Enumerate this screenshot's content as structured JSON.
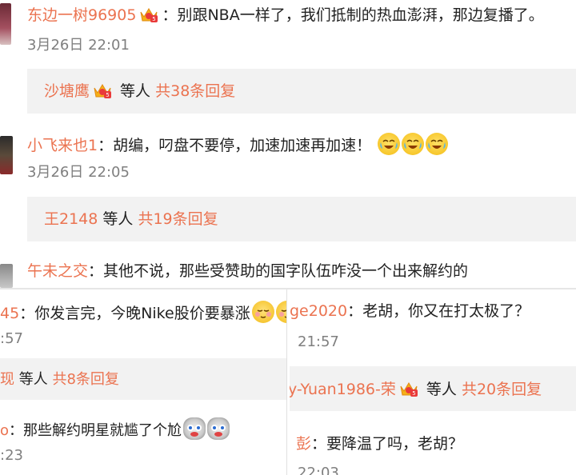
{
  "top": {
    "c1": {
      "name": "东边一树96905",
      "text": "：别跟NBA一样了，我们抵制的热血澎湃，那边复播了。",
      "time": "3月26日 22:01"
    },
    "r1": {
      "name": "沙塘鹰",
      "tail": " 等人 ",
      "count": "共38条回复"
    },
    "c2": {
      "name": "小飞来也1",
      "text": "：胡编，叼盘不要停，加速加速再加速！",
      "time": "3月26日 22:05"
    },
    "r2": {
      "name": "王2148",
      "tail": " 等人 ",
      "count": "共19条回复"
    },
    "c3": {
      "name": "午未之交",
      "text": "：其他不说，那些受赞助的国字队伍咋没一个出来解约的"
    }
  },
  "left": {
    "c1": {
      "name": "45",
      "text": "：你发言完，今晚Nike股价要暴涨",
      "time": ":57"
    },
    "r1": {
      "name": "现",
      "tail": " 等人 ",
      "count": "共8条回复"
    },
    "c2": {
      "name": "o",
      "text": "：那些解约明星就尴了个尬",
      "time": ":23"
    }
  },
  "right": {
    "c1": {
      "name": "ge2020",
      "text": "：老胡，你又在打太极了？",
      "time": "21:57"
    },
    "r1": {
      "name": "y-Yuan1986-荣",
      "tail": " 等人 ",
      "count": "共20条回复"
    },
    "c2": {
      "name": "彭",
      "text": "：要降温了吗，老胡？",
      "time": "22:03"
    }
  },
  "icons": {
    "crown": "vip-crown-icon",
    "cry": "laugh-cry-emoji",
    "shy": "shy-emoji",
    "dog": "husky-dog-emoji"
  },
  "colors": {
    "name": "#eb7350",
    "reply_bg": "#f2f2f2",
    "time": "#808080"
  }
}
